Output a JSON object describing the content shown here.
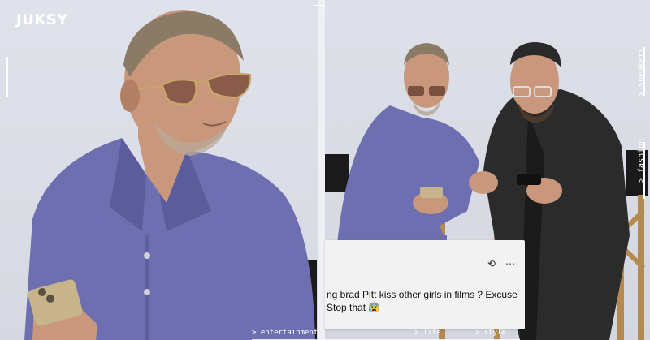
{
  "brand": {
    "logo_text": "JUKSY"
  },
  "tweet": {
    "line1": "ng brad Pitt kiss other girls in films ? Excuse",
    "line2": "Stop that 😰",
    "retweet_icon": "retweet-icon",
    "more_icon": "ellipsis-icon",
    "more_glyph": "⋯",
    "retweet_glyph": "⟲"
  },
  "side_nav": {
    "sneakers": "> sneakers",
    "fashion": "> fashion"
  },
  "bottom_nav": {
    "entertainment": "> entertainment",
    "life": "> life",
    "style": "> style"
  },
  "colors": {
    "shirt": "#6d6fb0",
    "background": "#d9dce3",
    "jacket": "#2b2b2b"
  }
}
